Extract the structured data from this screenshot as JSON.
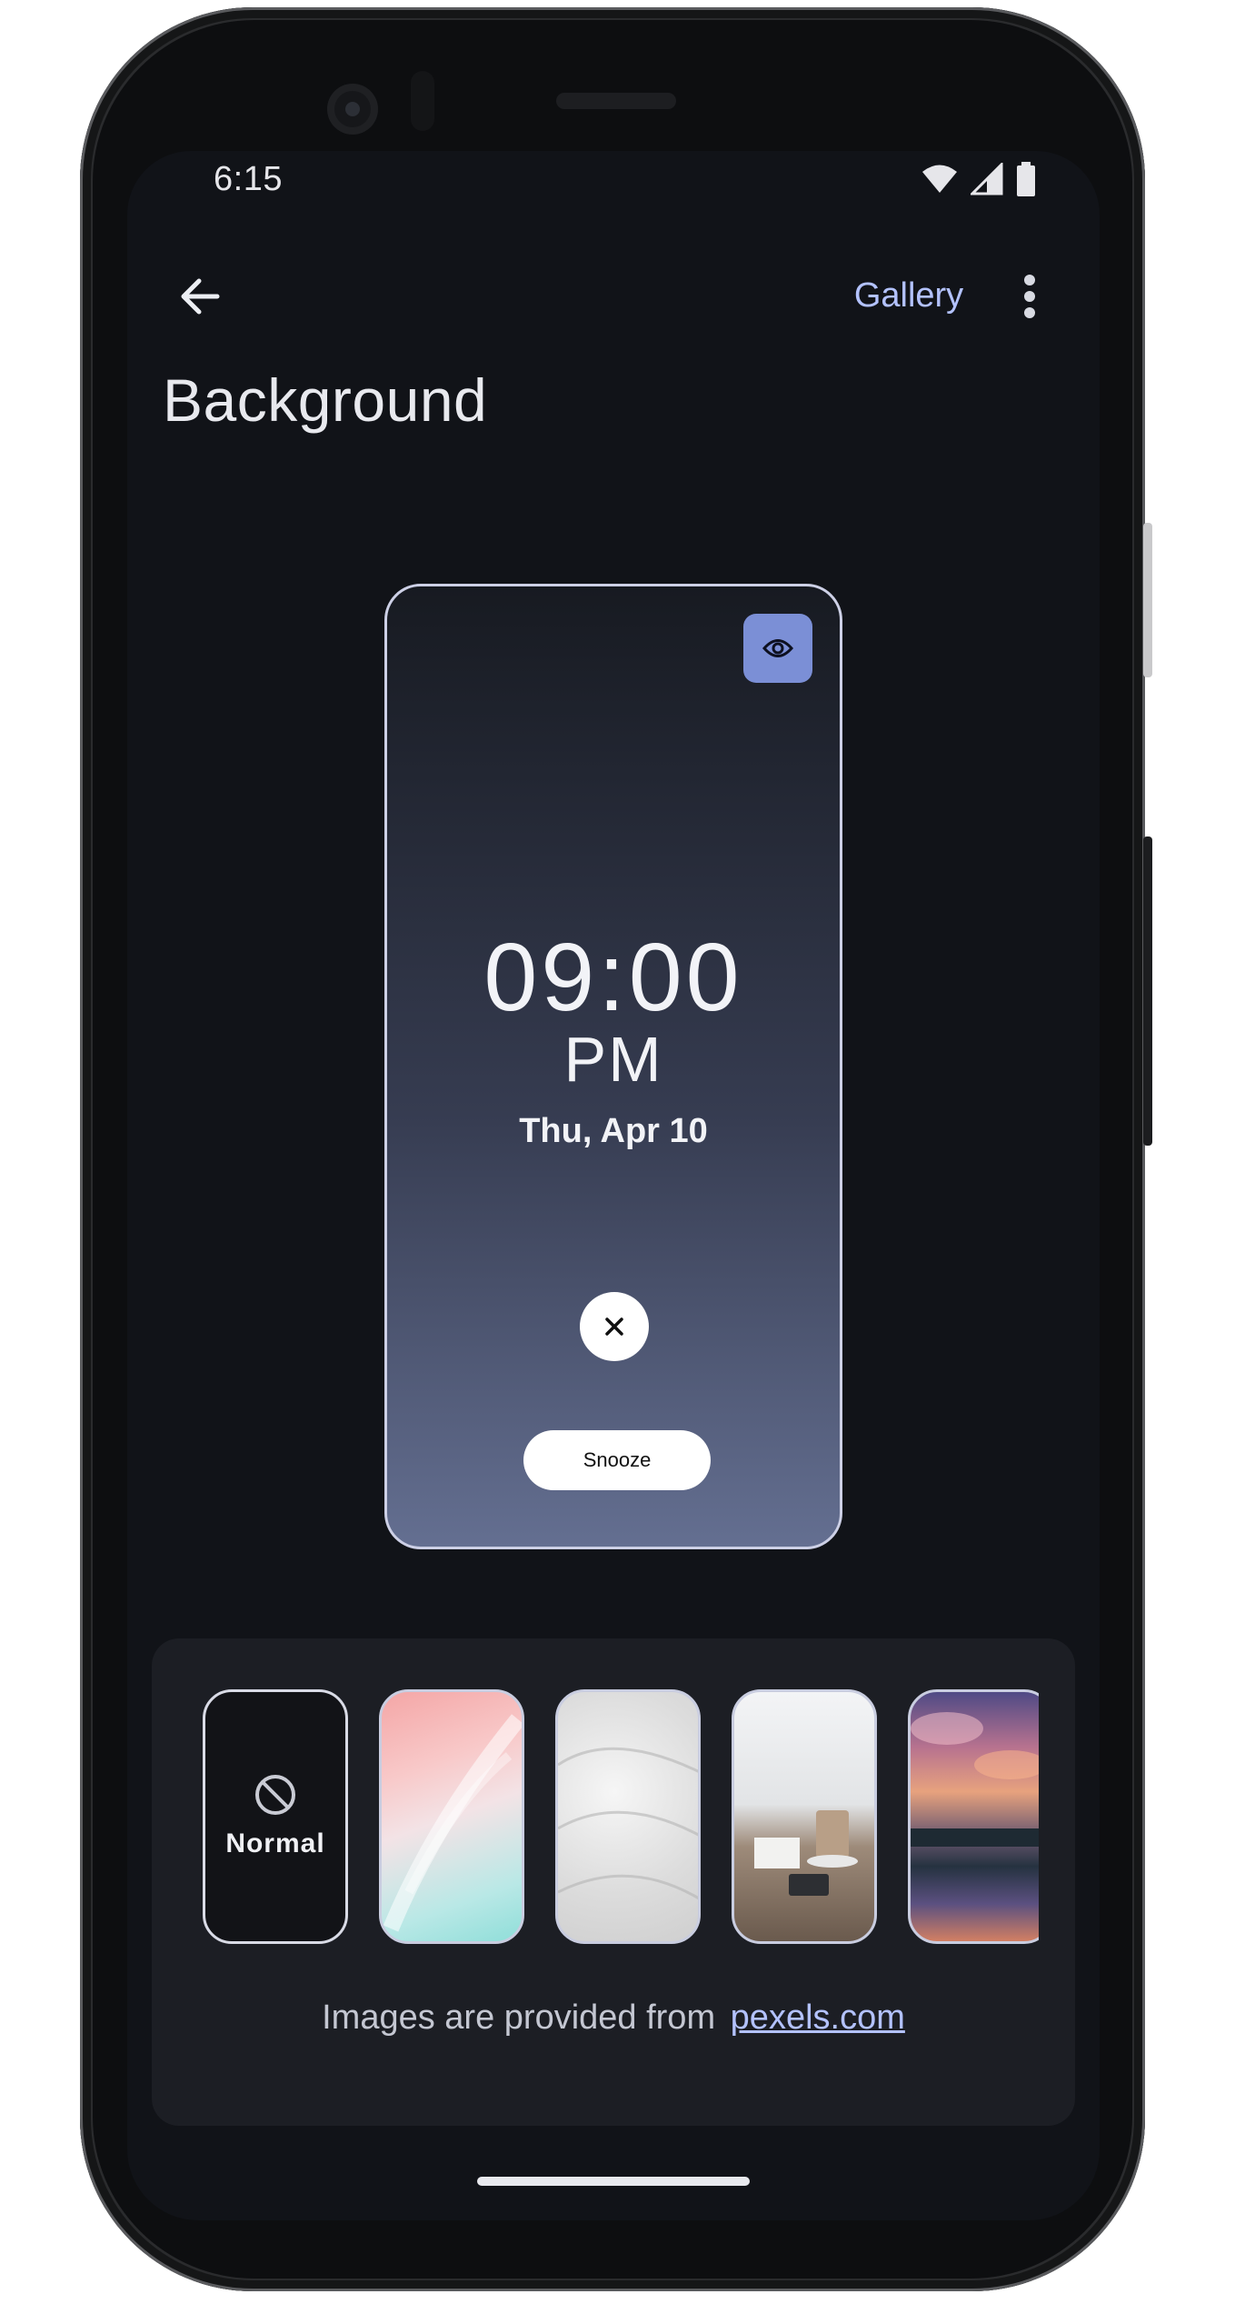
{
  "status_bar": {
    "time": "6:15"
  },
  "app_bar": {
    "gallery_label": "Gallery"
  },
  "page": {
    "title": "Background"
  },
  "preview": {
    "time": "09:00",
    "ampm": "PM",
    "date": "Thu, Apr 10",
    "snooze_label": "Snooze"
  },
  "backgrounds": {
    "normal_label": "Normal",
    "credit_text": "Images are provided from",
    "credit_link": "pexels.com"
  },
  "colors": {
    "accent": "#b3c2ff",
    "screen_bg": "#111318",
    "panel_bg": "#1c1e24",
    "eye_button": "#7b8fd6"
  }
}
